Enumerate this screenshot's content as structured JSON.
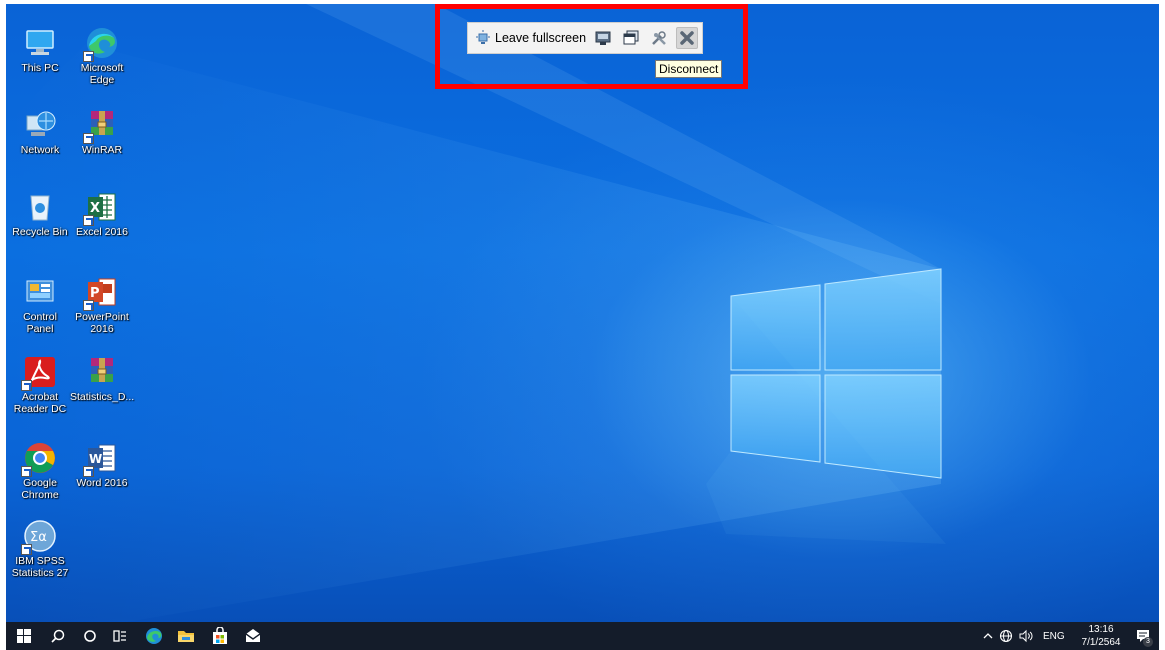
{
  "desktop": {
    "icons": [
      {
        "label": "This PC",
        "icon": "this-pc-icon"
      },
      {
        "label": "Microsoft\nEdge",
        "icon": "edge-icon"
      },
      {
        "label": "Network",
        "icon": "network-icon"
      },
      {
        "label": "WinRAR",
        "icon": "winrar-icon"
      },
      {
        "label": "Recycle Bin",
        "icon": "recycle-bin-icon"
      },
      {
        "label": "Excel 2016",
        "icon": "excel-icon"
      },
      {
        "label": "Control\nPanel",
        "icon": "control-panel-icon"
      },
      {
        "label": "PowerPoint\n2016",
        "icon": "powerpoint-icon"
      },
      {
        "label": "Acrobat\nReader DC",
        "icon": "acrobat-icon"
      },
      {
        "label": "Statistics_D...",
        "icon": "winrar-archive-icon"
      },
      {
        "label": "Google\nChrome",
        "icon": "chrome-icon"
      },
      {
        "label": "Word 2016",
        "icon": "word-icon"
      },
      {
        "label": "IBM SPSS\nStatistics 27",
        "icon": "spss-icon"
      }
    ]
  },
  "remote_toolbar": {
    "leave_fullscreen_label": "Leave fullscreen",
    "buttons": [
      "display-settings-icon",
      "window-icon",
      "settings-tools-icon",
      "disconnect-icon"
    ],
    "tooltip": "Disconnect"
  },
  "taskbar": {
    "pinned": [
      "start-icon",
      "search-icon",
      "cortana-icon",
      "task-view-icon",
      "edge-icon",
      "file-explorer-icon",
      "store-icon",
      "mail-icon"
    ],
    "tray": {
      "language": "ENG",
      "time": "13:16",
      "date": "7/1/2564",
      "notification_count": "3"
    }
  },
  "colors": {
    "desktop_blue": "#0a63d6",
    "taskbar": "#141c2a",
    "highlight_red": "#ff0000",
    "tooltip_bg": "#ffffe1"
  }
}
